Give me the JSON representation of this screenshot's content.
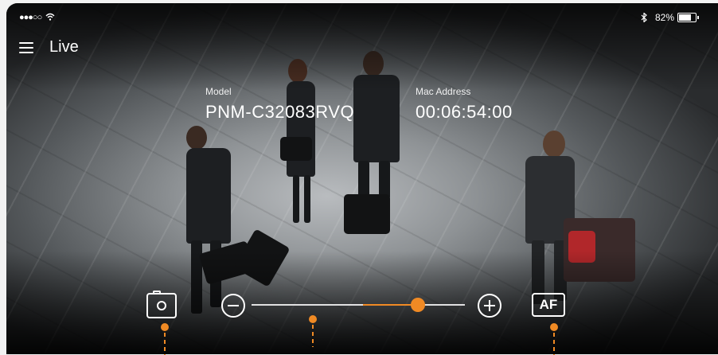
{
  "status_bar": {
    "signal": "●●●○○",
    "wifi_icon": "wifi-icon",
    "bluetooth_icon": "bluetooth-icon",
    "battery_text": "82%",
    "battery_level": 0.82
  },
  "header": {
    "menu_icon": "hamburger-menu-icon",
    "title": "Live"
  },
  "info": {
    "model_label": "Model",
    "model_value": "PNM-C32083RVQ",
    "mac_label": "Mac Address",
    "mac_value": "00:06:54:00"
  },
  "controls": {
    "capture_icon": "camera-icon",
    "zoom_out_icon": "minus-circle-icon",
    "zoom_in_icon": "plus-circle-icon",
    "zoom_level": 0.78,
    "af_label": "AF"
  },
  "colors": {
    "accent": "#f08a24",
    "text": "#ffffff"
  }
}
